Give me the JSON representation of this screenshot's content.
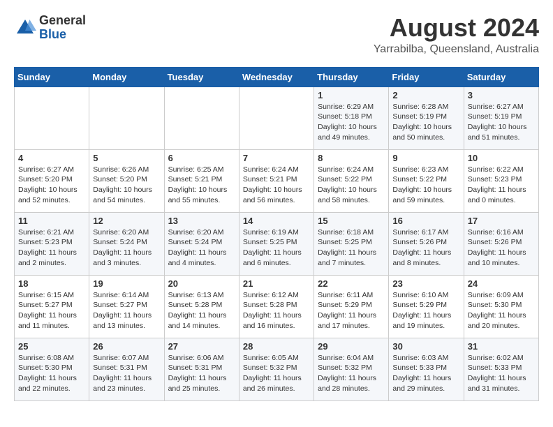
{
  "header": {
    "logo": {
      "general": "General",
      "blue": "Blue"
    },
    "title": "August 2024",
    "subtitle": "Yarrabilba, Queensland, Australia"
  },
  "days_of_week": [
    "Sunday",
    "Monday",
    "Tuesday",
    "Wednesday",
    "Thursday",
    "Friday",
    "Saturday"
  ],
  "weeks": [
    [
      {
        "day": "",
        "info": ""
      },
      {
        "day": "",
        "info": ""
      },
      {
        "day": "",
        "info": ""
      },
      {
        "day": "",
        "info": ""
      },
      {
        "day": "1",
        "info": "Sunrise: 6:29 AM\nSunset: 5:18 PM\nDaylight: 10 hours\nand 49 minutes."
      },
      {
        "day": "2",
        "info": "Sunrise: 6:28 AM\nSunset: 5:19 PM\nDaylight: 10 hours\nand 50 minutes."
      },
      {
        "day": "3",
        "info": "Sunrise: 6:27 AM\nSunset: 5:19 PM\nDaylight: 10 hours\nand 51 minutes."
      }
    ],
    [
      {
        "day": "4",
        "info": "Sunrise: 6:27 AM\nSunset: 5:20 PM\nDaylight: 10 hours\nand 52 minutes."
      },
      {
        "day": "5",
        "info": "Sunrise: 6:26 AM\nSunset: 5:20 PM\nDaylight: 10 hours\nand 54 minutes."
      },
      {
        "day": "6",
        "info": "Sunrise: 6:25 AM\nSunset: 5:21 PM\nDaylight: 10 hours\nand 55 minutes."
      },
      {
        "day": "7",
        "info": "Sunrise: 6:24 AM\nSunset: 5:21 PM\nDaylight: 10 hours\nand 56 minutes."
      },
      {
        "day": "8",
        "info": "Sunrise: 6:24 AM\nSunset: 5:22 PM\nDaylight: 10 hours\nand 58 minutes."
      },
      {
        "day": "9",
        "info": "Sunrise: 6:23 AM\nSunset: 5:22 PM\nDaylight: 10 hours\nand 59 minutes."
      },
      {
        "day": "10",
        "info": "Sunrise: 6:22 AM\nSunset: 5:23 PM\nDaylight: 11 hours\nand 0 minutes."
      }
    ],
    [
      {
        "day": "11",
        "info": "Sunrise: 6:21 AM\nSunset: 5:23 PM\nDaylight: 11 hours\nand 2 minutes."
      },
      {
        "day": "12",
        "info": "Sunrise: 6:20 AM\nSunset: 5:24 PM\nDaylight: 11 hours\nand 3 minutes."
      },
      {
        "day": "13",
        "info": "Sunrise: 6:20 AM\nSunset: 5:24 PM\nDaylight: 11 hours\nand 4 minutes."
      },
      {
        "day": "14",
        "info": "Sunrise: 6:19 AM\nSunset: 5:25 PM\nDaylight: 11 hours\nand 6 minutes."
      },
      {
        "day": "15",
        "info": "Sunrise: 6:18 AM\nSunset: 5:25 PM\nDaylight: 11 hours\nand 7 minutes."
      },
      {
        "day": "16",
        "info": "Sunrise: 6:17 AM\nSunset: 5:26 PM\nDaylight: 11 hours\nand 8 minutes."
      },
      {
        "day": "17",
        "info": "Sunrise: 6:16 AM\nSunset: 5:26 PM\nDaylight: 11 hours\nand 10 minutes."
      }
    ],
    [
      {
        "day": "18",
        "info": "Sunrise: 6:15 AM\nSunset: 5:27 PM\nDaylight: 11 hours\nand 11 minutes."
      },
      {
        "day": "19",
        "info": "Sunrise: 6:14 AM\nSunset: 5:27 PM\nDaylight: 11 hours\nand 13 minutes."
      },
      {
        "day": "20",
        "info": "Sunrise: 6:13 AM\nSunset: 5:28 PM\nDaylight: 11 hours\nand 14 minutes."
      },
      {
        "day": "21",
        "info": "Sunrise: 6:12 AM\nSunset: 5:28 PM\nDaylight: 11 hours\nand 16 minutes."
      },
      {
        "day": "22",
        "info": "Sunrise: 6:11 AM\nSunset: 5:29 PM\nDaylight: 11 hours\nand 17 minutes."
      },
      {
        "day": "23",
        "info": "Sunrise: 6:10 AM\nSunset: 5:29 PM\nDaylight: 11 hours\nand 19 minutes."
      },
      {
        "day": "24",
        "info": "Sunrise: 6:09 AM\nSunset: 5:30 PM\nDaylight: 11 hours\nand 20 minutes."
      }
    ],
    [
      {
        "day": "25",
        "info": "Sunrise: 6:08 AM\nSunset: 5:30 PM\nDaylight: 11 hours\nand 22 minutes."
      },
      {
        "day": "26",
        "info": "Sunrise: 6:07 AM\nSunset: 5:31 PM\nDaylight: 11 hours\nand 23 minutes."
      },
      {
        "day": "27",
        "info": "Sunrise: 6:06 AM\nSunset: 5:31 PM\nDaylight: 11 hours\nand 25 minutes."
      },
      {
        "day": "28",
        "info": "Sunrise: 6:05 AM\nSunset: 5:32 PM\nDaylight: 11 hours\nand 26 minutes."
      },
      {
        "day": "29",
        "info": "Sunrise: 6:04 AM\nSunset: 5:32 PM\nDaylight: 11 hours\nand 28 minutes."
      },
      {
        "day": "30",
        "info": "Sunrise: 6:03 AM\nSunset: 5:33 PM\nDaylight: 11 hours\nand 29 minutes."
      },
      {
        "day": "31",
        "info": "Sunrise: 6:02 AM\nSunset: 5:33 PM\nDaylight: 11 hours\nand 31 minutes."
      }
    ]
  ]
}
